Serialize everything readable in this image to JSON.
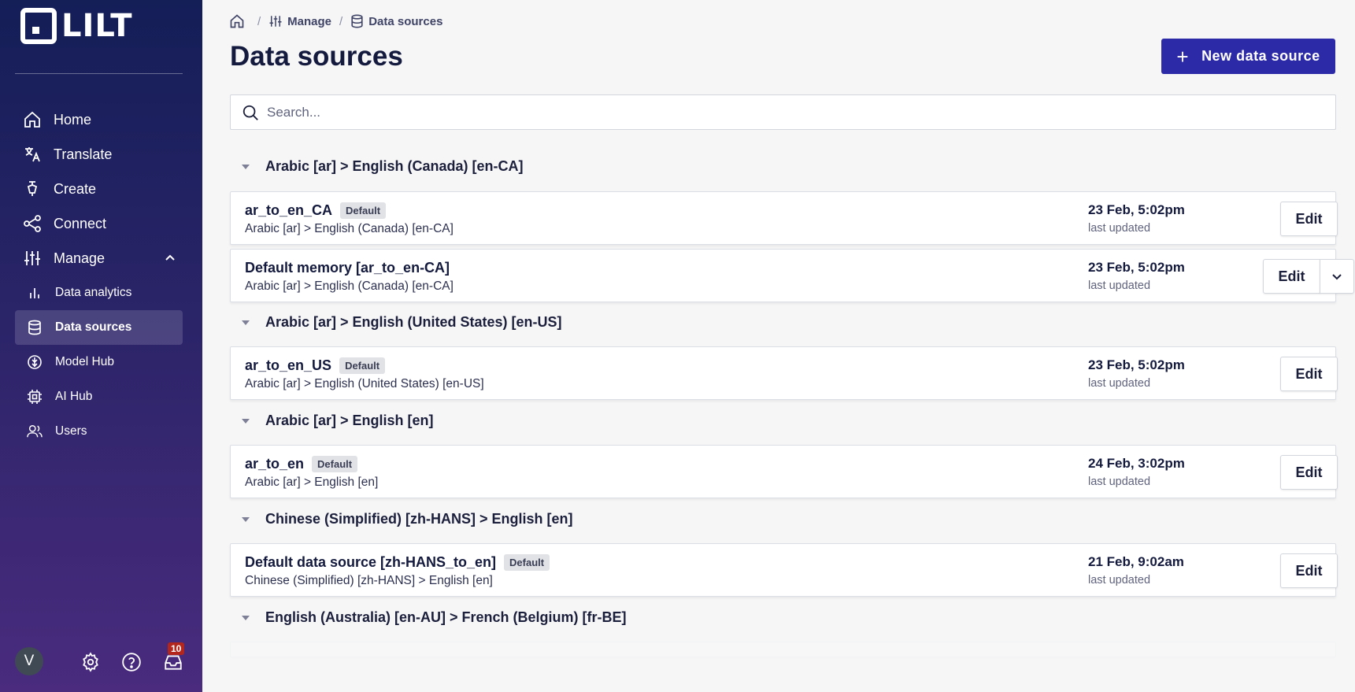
{
  "brand": {
    "name": "LILT"
  },
  "sidebar": {
    "items": [
      {
        "label": "Home",
        "icon": "home-icon"
      },
      {
        "label": "Translate",
        "icon": "translate-icon"
      },
      {
        "label": "Create",
        "icon": "pen-icon"
      },
      {
        "label": "Connect",
        "icon": "share-icon"
      },
      {
        "label": "Manage",
        "icon": "sliders-icon",
        "expanded": true
      }
    ],
    "subitems": [
      {
        "label": "Data analytics",
        "icon": "bar-chart-icon"
      },
      {
        "label": "Data sources",
        "icon": "database-icon",
        "active": true
      },
      {
        "label": "Model Hub",
        "icon": "model-icon"
      },
      {
        "label": "AI Hub",
        "icon": "chip-icon"
      },
      {
        "label": "Users",
        "icon": "users-icon"
      }
    ],
    "footer": {
      "avatar_initial": "V",
      "inbox_count": "10"
    }
  },
  "breadcrumb": {
    "manage": "Manage",
    "data_sources": "Data sources",
    "separator": "/"
  },
  "page": {
    "title": "Data sources",
    "new_button": "New data source",
    "search_placeholder": "Search..."
  },
  "groups": [
    {
      "title": "Arabic [ar] > English (Canada) [en-CA]",
      "items": [
        {
          "name": "ar_to_en_CA",
          "default": "Default",
          "pair": "Arabic [ar] > English (Canada) [en-CA]",
          "date": "23 Feb, 5:02pm",
          "updated": "last updated",
          "edit": "Edit"
        },
        {
          "name": "Default memory [ar_to_en-CA]",
          "pair": "Arabic [ar] > English (Canada) [en-CA]",
          "date": "23 Feb, 5:02pm",
          "updated": "last updated",
          "edit": "Edit"
        }
      ]
    },
    {
      "title": "Arabic [ar] > English (United States) [en-US]",
      "items": [
        {
          "name": "ar_to_en_US",
          "default": "Default",
          "pair": "Arabic [ar] > English (United States) [en-US]",
          "date": "23 Feb, 5:02pm",
          "updated": "last updated",
          "edit": "Edit"
        }
      ]
    },
    {
      "title": "Arabic [ar] > English [en]",
      "items": [
        {
          "name": "ar_to_en",
          "default": "Default",
          "pair": "Arabic [ar] > English [en]",
          "date": "24 Feb, 3:02pm",
          "updated": "last updated",
          "edit": "Edit"
        }
      ]
    },
    {
      "title": "Chinese (Simplified) [zh-HANS] > English [en]",
      "items": [
        {
          "name": "Default data source [zh-HANS_to_en]",
          "default": "Default",
          "pair": "Chinese (Simplified) [zh-HANS] > English [en]",
          "date": "21 Feb, 9:02am",
          "updated": "last updated",
          "edit": "Edit"
        }
      ]
    },
    {
      "title": "English (Australia) [en-AU] > French (Belgium) [fr-BE]"
    }
  ]
}
